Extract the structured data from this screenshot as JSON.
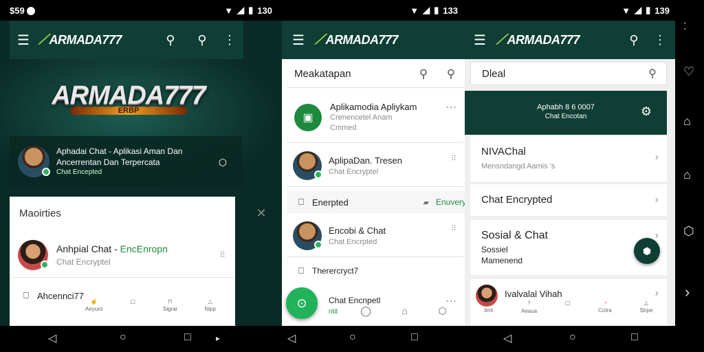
{
  "status": {
    "left_time": "59",
    "right_p1": "130",
    "right_p2": "133",
    "right_p3": "139"
  },
  "brand": "ARMADA777",
  "panel1": {
    "hero_logo": "ARMADA777",
    "hero_sub": "ERBP",
    "profile": {
      "title": "Aphadai Chat - Aplikasi Aman Dan",
      "subtitle": "Ancerrentan Dan Terpercata",
      "tag": "Chat Encepted"
    },
    "sheet_title": "Maoirties",
    "chat_name": "Anhpial Chat - ",
    "chat_name_green": "EncEnropn",
    "chat_status": "Chat Encryptel",
    "section_label": "Ahcennci77",
    "bottom_tabs": [
      "Aeyuro",
      "",
      "Sigrai",
      "Nipp"
    ]
  },
  "panel2": {
    "search_placeholder": "Meakatapan",
    "items": [
      {
        "name": "Aplikamodia Apliykam",
        "line1": "Crenencetel Anam",
        "line2": "Cmmed"
      },
      {
        "name": "AplipaDan. Tresen",
        "line1": "Chat Encryptel",
        "line2": ""
      },
      {
        "name": "Encobi & Chat",
        "line1": "Chat Encrpted",
        "line2": ""
      }
    ],
    "section_encrypted": "Enerpted",
    "section_encrypted_green": "Enuvery",
    "section_label2": "Therercryct7",
    "last_item": "Chat Encnpetl",
    "last_item_green": "ntit"
  },
  "panel3": {
    "search_placeholder": "Dleal",
    "banner_title": "Aphabh 8 6 0007",
    "banner_sub": "Chat Encotan",
    "items": [
      {
        "title": "NIVAChal",
        "sub": "Mensndangd Aamis 's"
      },
      {
        "title": "Chat Encrypted",
        "sub": ""
      },
      {
        "title": "Sosial & Chat",
        "sub": "Sossiel",
        "sub2": "Mamenend"
      }
    ],
    "last_item": "Ivalvalal Vihah",
    "bottom_tabs": [
      "Ilmt",
      "Aeaua",
      "",
      "Cotra",
      "Strpe"
    ]
  }
}
